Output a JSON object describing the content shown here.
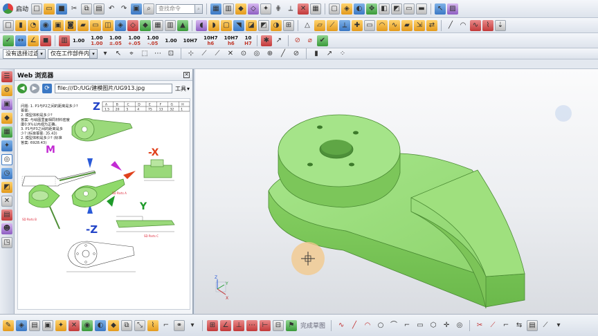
{
  "menu": {
    "start_label": "启动",
    "search_placeholder": "查找命令"
  },
  "toolbar_row2": {
    "precision_buttons": [
      {
        "top": "1.00",
        "bottom": ""
      },
      {
        "top": "1.00",
        "bottom": "1.00"
      },
      {
        "top": "1.00",
        "bottom": "±.05"
      },
      {
        "top": "1.00",
        "bottom": "+.05"
      },
      {
        "top": "1.00",
        "bottom": "-.05"
      },
      {
        "top": "1.00",
        "bottom": ""
      },
      {
        "top": "10H7",
        "bottom": ""
      },
      {
        "top": "10H7",
        "bottom": "h6"
      },
      {
        "top": "10H7",
        "bottom": "h6"
      },
      {
        "top": "10",
        "bottom": "H7"
      }
    ]
  },
  "selection_bar": {
    "filter_value": "没有选择过滤器",
    "scope_value": "仅在工作部件内"
  },
  "web_panel": {
    "title": "Web 浏览器",
    "url": "file:///D:/UG/建模图片/UG913.jpg",
    "tools_label": "工具",
    "doc": {
      "questions": [
        "问题: 1. P1与P2之间的距离是多少?",
        "答案:",
        "2. 模型体积是多少?",
        "答案: 与绘图里面相同材料密度",
        "度0.9%以内视为正确。",
        "3. P1与P3之间的距离是多",
        "少? (标准答案: 35.43)",
        "2. 模型体积是多少? (标准",
        "答案: 6928.43)"
      ],
      "view_labels": {
        "z": "Z",
        "m": "M",
        "neg_x": "-X",
        "y": "Y",
        "neg_z": "-Z"
      },
      "table_headers": [
        "A",
        "B",
        "C",
        "D",
        "E",
        "F",
        "G",
        "H"
      ],
      "table_values": [
        "1.5",
        "20",
        "5",
        "4",
        "75",
        "13",
        "32",
        "1"
      ],
      "annotation_texts": [
        "SD Parts A",
        "SD Parts B",
        "SD Parts C"
      ]
    }
  },
  "triad_labels": {
    "z": "Z",
    "x": "X",
    "y": "Y"
  },
  "bottom_bar": {
    "sketch_label": "完成草图"
  },
  "colors": {
    "part_green": "#8fd96a",
    "part_green_dark": "#5fae3f",
    "toolbar_bg": "#e6ebf2",
    "accent_blue": "#3b78c4",
    "cursor_circle": "#f2c98d"
  }
}
